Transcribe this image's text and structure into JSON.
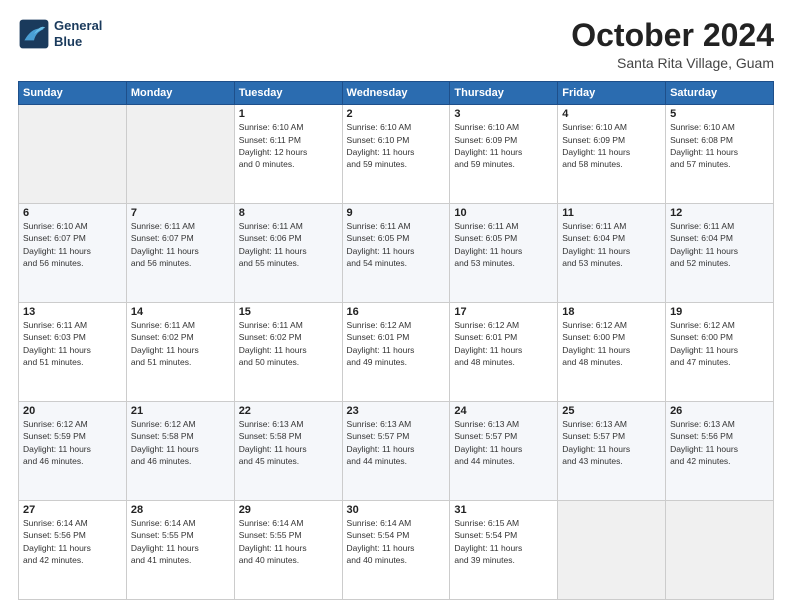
{
  "header": {
    "logo_line1": "General",
    "logo_line2": "Blue",
    "title": "October 2024",
    "subtitle": "Santa Rita Village, Guam"
  },
  "days_of_week": [
    "Sunday",
    "Monday",
    "Tuesday",
    "Wednesday",
    "Thursday",
    "Friday",
    "Saturday"
  ],
  "weeks": [
    [
      {
        "day": "",
        "info": ""
      },
      {
        "day": "",
        "info": ""
      },
      {
        "day": "1",
        "info": "Sunrise: 6:10 AM\nSunset: 6:11 PM\nDaylight: 12 hours\nand 0 minutes."
      },
      {
        "day": "2",
        "info": "Sunrise: 6:10 AM\nSunset: 6:10 PM\nDaylight: 11 hours\nand 59 minutes."
      },
      {
        "day": "3",
        "info": "Sunrise: 6:10 AM\nSunset: 6:09 PM\nDaylight: 11 hours\nand 59 minutes."
      },
      {
        "day": "4",
        "info": "Sunrise: 6:10 AM\nSunset: 6:09 PM\nDaylight: 11 hours\nand 58 minutes."
      },
      {
        "day": "5",
        "info": "Sunrise: 6:10 AM\nSunset: 6:08 PM\nDaylight: 11 hours\nand 57 minutes."
      }
    ],
    [
      {
        "day": "6",
        "info": "Sunrise: 6:10 AM\nSunset: 6:07 PM\nDaylight: 11 hours\nand 56 minutes."
      },
      {
        "day": "7",
        "info": "Sunrise: 6:11 AM\nSunset: 6:07 PM\nDaylight: 11 hours\nand 56 minutes."
      },
      {
        "day": "8",
        "info": "Sunrise: 6:11 AM\nSunset: 6:06 PM\nDaylight: 11 hours\nand 55 minutes."
      },
      {
        "day": "9",
        "info": "Sunrise: 6:11 AM\nSunset: 6:05 PM\nDaylight: 11 hours\nand 54 minutes."
      },
      {
        "day": "10",
        "info": "Sunrise: 6:11 AM\nSunset: 6:05 PM\nDaylight: 11 hours\nand 53 minutes."
      },
      {
        "day": "11",
        "info": "Sunrise: 6:11 AM\nSunset: 6:04 PM\nDaylight: 11 hours\nand 53 minutes."
      },
      {
        "day": "12",
        "info": "Sunrise: 6:11 AM\nSunset: 6:04 PM\nDaylight: 11 hours\nand 52 minutes."
      }
    ],
    [
      {
        "day": "13",
        "info": "Sunrise: 6:11 AM\nSunset: 6:03 PM\nDaylight: 11 hours\nand 51 minutes."
      },
      {
        "day": "14",
        "info": "Sunrise: 6:11 AM\nSunset: 6:02 PM\nDaylight: 11 hours\nand 51 minutes."
      },
      {
        "day": "15",
        "info": "Sunrise: 6:11 AM\nSunset: 6:02 PM\nDaylight: 11 hours\nand 50 minutes."
      },
      {
        "day": "16",
        "info": "Sunrise: 6:12 AM\nSunset: 6:01 PM\nDaylight: 11 hours\nand 49 minutes."
      },
      {
        "day": "17",
        "info": "Sunrise: 6:12 AM\nSunset: 6:01 PM\nDaylight: 11 hours\nand 48 minutes."
      },
      {
        "day": "18",
        "info": "Sunrise: 6:12 AM\nSunset: 6:00 PM\nDaylight: 11 hours\nand 48 minutes."
      },
      {
        "day": "19",
        "info": "Sunrise: 6:12 AM\nSunset: 6:00 PM\nDaylight: 11 hours\nand 47 minutes."
      }
    ],
    [
      {
        "day": "20",
        "info": "Sunrise: 6:12 AM\nSunset: 5:59 PM\nDaylight: 11 hours\nand 46 minutes."
      },
      {
        "day": "21",
        "info": "Sunrise: 6:12 AM\nSunset: 5:58 PM\nDaylight: 11 hours\nand 46 minutes."
      },
      {
        "day": "22",
        "info": "Sunrise: 6:13 AM\nSunset: 5:58 PM\nDaylight: 11 hours\nand 45 minutes."
      },
      {
        "day": "23",
        "info": "Sunrise: 6:13 AM\nSunset: 5:57 PM\nDaylight: 11 hours\nand 44 minutes."
      },
      {
        "day": "24",
        "info": "Sunrise: 6:13 AM\nSunset: 5:57 PM\nDaylight: 11 hours\nand 44 minutes."
      },
      {
        "day": "25",
        "info": "Sunrise: 6:13 AM\nSunset: 5:57 PM\nDaylight: 11 hours\nand 43 minutes."
      },
      {
        "day": "26",
        "info": "Sunrise: 6:13 AM\nSunset: 5:56 PM\nDaylight: 11 hours\nand 42 minutes."
      }
    ],
    [
      {
        "day": "27",
        "info": "Sunrise: 6:14 AM\nSunset: 5:56 PM\nDaylight: 11 hours\nand 42 minutes."
      },
      {
        "day": "28",
        "info": "Sunrise: 6:14 AM\nSunset: 5:55 PM\nDaylight: 11 hours\nand 41 minutes."
      },
      {
        "day": "29",
        "info": "Sunrise: 6:14 AM\nSunset: 5:55 PM\nDaylight: 11 hours\nand 40 minutes."
      },
      {
        "day": "30",
        "info": "Sunrise: 6:14 AM\nSunset: 5:54 PM\nDaylight: 11 hours\nand 40 minutes."
      },
      {
        "day": "31",
        "info": "Sunrise: 6:15 AM\nSunset: 5:54 PM\nDaylight: 11 hours\nand 39 minutes."
      },
      {
        "day": "",
        "info": ""
      },
      {
        "day": "",
        "info": ""
      }
    ]
  ]
}
